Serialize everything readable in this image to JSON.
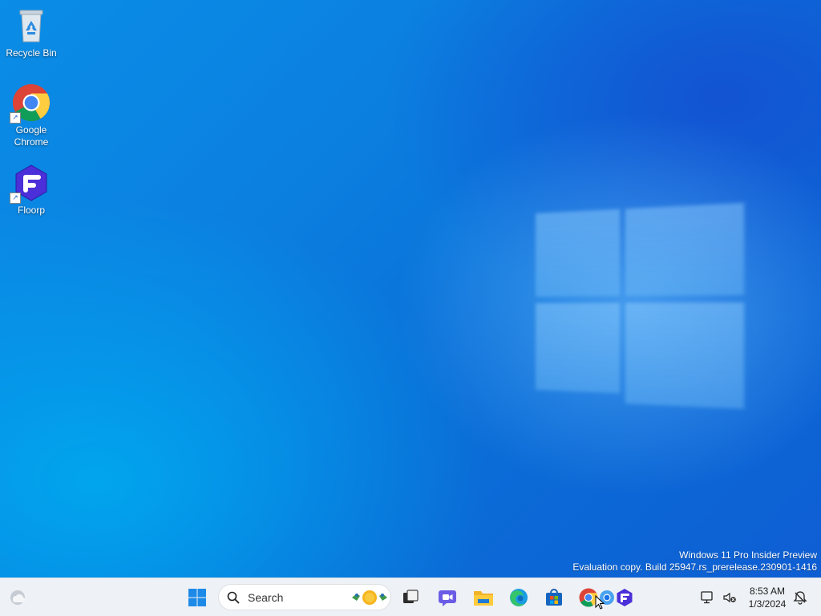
{
  "desktop": {
    "icons": [
      {
        "label": "Recycle Bin",
        "icon": "recycle-bin-icon"
      },
      {
        "label": "Google Chrome",
        "icon": "chrome-icon"
      },
      {
        "label": "Floorp",
        "icon": "floorp-icon"
      }
    ],
    "watermark": {
      "line1": "Windows 11 Pro Insider Preview",
      "line2": "Evaluation copy. Build 25947.rs_prerelease.230901-1416"
    }
  },
  "taskbar": {
    "search": {
      "placeholder": "Search"
    },
    "pinned": [
      {
        "icon": "widgets-weather-icon"
      },
      {
        "icon": "start-windows-icon"
      },
      {
        "icon": "search-icon"
      },
      {
        "icon": "task-view-icon"
      },
      {
        "icon": "meet-chat-icon"
      },
      {
        "icon": "file-explorer-icon"
      },
      {
        "icon": "edge-icon"
      },
      {
        "icon": "microsoft-store-icon"
      },
      {
        "icon": "chrome-icon"
      },
      {
        "icon": "chrome-alt-icon"
      },
      {
        "icon": "floorp-icon"
      }
    ],
    "tray": {
      "time": "8:53 AM",
      "date": "1/3/2024"
    }
  },
  "colors": {
    "desktop_blue": "#0a7fe0",
    "taskbar_bg": "#eef1f5",
    "windows_blue": "#1e8ae8"
  }
}
